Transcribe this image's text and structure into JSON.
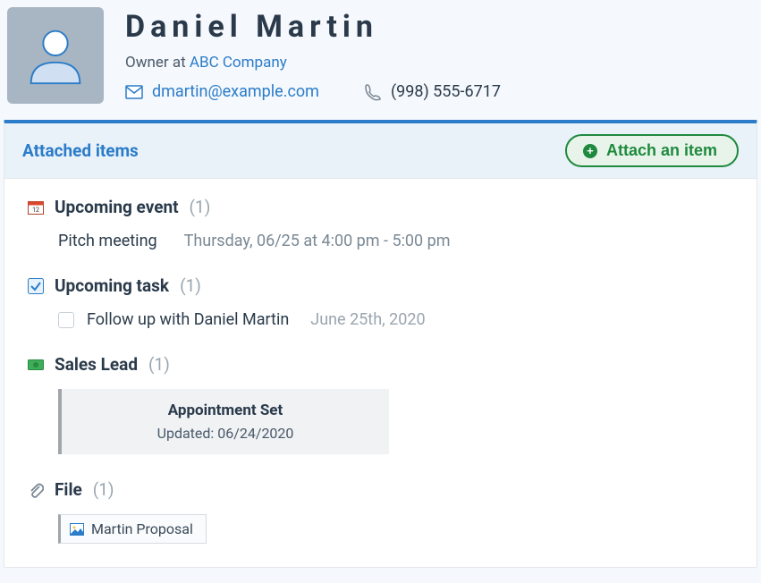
{
  "profile": {
    "name": "Daniel Martin",
    "role_prefix": "Owner at ",
    "company": "ABC Company",
    "email": "dmartin@example.com",
    "phone": "(998) 555-6717"
  },
  "panel": {
    "title": "Attached items",
    "attach_button": "Attach an item"
  },
  "sections": {
    "event": {
      "title": "Upcoming event",
      "count": "(1)",
      "name": "Pitch meeting",
      "date": "Thursday, 06/25 at 4:00 pm - 5:00 pm"
    },
    "task": {
      "title": "Upcoming task",
      "count": "(1)",
      "name": "Follow up with Daniel Martin",
      "date": "June 25th, 2020"
    },
    "lead": {
      "title": "Sales Lead",
      "count": "(1)",
      "card_title": "Appointment Set",
      "card_sub": "Updated: 06/24/2020"
    },
    "file": {
      "title": "File",
      "count": "(1)",
      "name": "Martin Proposal"
    }
  }
}
